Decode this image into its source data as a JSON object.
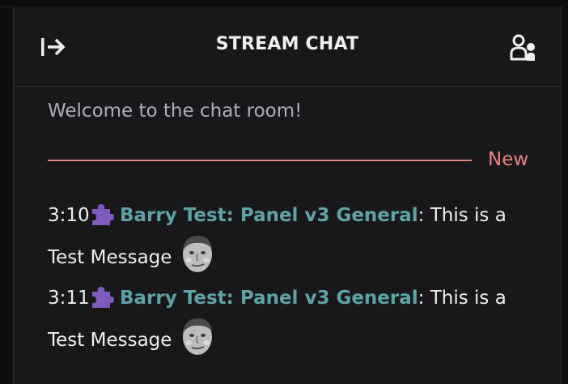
{
  "header": {
    "title": "STREAM CHAT",
    "collapse_icon": "arrow-right-to-line-icon",
    "users_icon": "community-users-icon"
  },
  "chat": {
    "welcome": "Welcome to the chat room!",
    "new_marker": "New",
    "messages": [
      {
        "time": "3:10",
        "badge_icon": "puzzle-piece-icon",
        "username": "Barry Test: Panel v3 General",
        "separator": ":",
        "text": " This is a Test Message",
        "emote": "kappa-face-emote"
      },
      {
        "time": "3:11",
        "badge_icon": "puzzle-piece-icon",
        "username": "Barry Test: Panel v3 General",
        "separator": ":",
        "text": " This is a Test Message",
        "emote": "kappa-face-emote"
      }
    ]
  },
  "colors": {
    "background": "#18181b",
    "username": "#5fa2a6",
    "new_marker": "#e8827f",
    "badge": "#7e5bbd",
    "text": "#efeff1",
    "muted_text": "#adadb8"
  }
}
